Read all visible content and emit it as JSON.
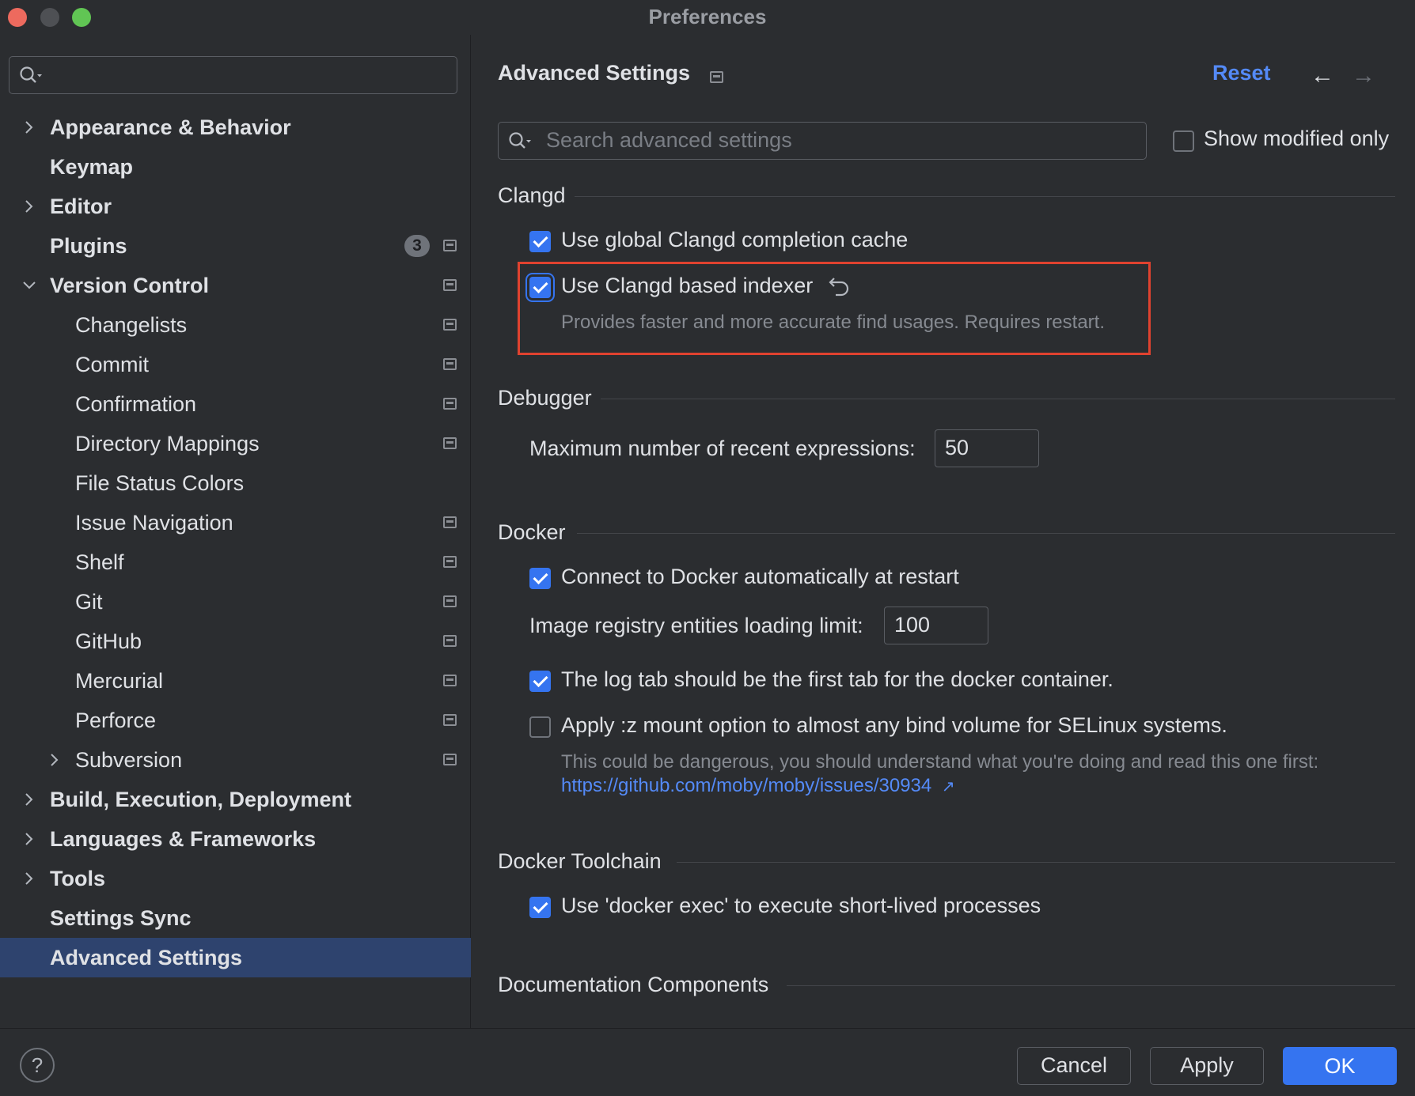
{
  "window": {
    "title": "Preferences"
  },
  "sidebar": {
    "search_placeholder": "",
    "items": [
      {
        "label": "Appearance & Behavior",
        "level": 0,
        "expander": "collapsed",
        "icon": false
      },
      {
        "label": "Keymap",
        "level": 0,
        "expander": "none",
        "icon": false
      },
      {
        "label": "Editor",
        "level": 0,
        "expander": "collapsed",
        "icon": false
      },
      {
        "label": "Plugins",
        "level": 0,
        "expander": "none",
        "icon": true,
        "badge": "3"
      },
      {
        "label": "Version Control",
        "level": 0,
        "expander": "expanded",
        "icon": true
      },
      {
        "label": "Changelists",
        "level": 1,
        "expander": "none",
        "icon": true
      },
      {
        "label": "Commit",
        "level": 1,
        "expander": "none",
        "icon": true
      },
      {
        "label": "Confirmation",
        "level": 1,
        "expander": "none",
        "icon": true
      },
      {
        "label": "Directory Mappings",
        "level": 1,
        "expander": "none",
        "icon": true
      },
      {
        "label": "File Status Colors",
        "level": 1,
        "expander": "none",
        "icon": false
      },
      {
        "label": "Issue Navigation",
        "level": 1,
        "expander": "none",
        "icon": true
      },
      {
        "label": "Shelf",
        "level": 1,
        "expander": "none",
        "icon": true
      },
      {
        "label": "Git",
        "level": 1,
        "expander": "none",
        "icon": true
      },
      {
        "label": "GitHub",
        "level": 1,
        "expander": "none",
        "icon": true
      },
      {
        "label": "Mercurial",
        "level": 1,
        "expander": "none",
        "icon": true
      },
      {
        "label": "Perforce",
        "level": 1,
        "expander": "none",
        "icon": true
      },
      {
        "label": "Subversion",
        "level": 1,
        "expander": "collapsed",
        "icon": true
      },
      {
        "label": "Build, Execution, Deployment",
        "level": 0,
        "expander": "collapsed",
        "icon": false
      },
      {
        "label": "Languages & Frameworks",
        "level": 0,
        "expander": "collapsed",
        "icon": false
      },
      {
        "label": "Tools",
        "level": 0,
        "expander": "collapsed",
        "icon": false
      },
      {
        "label": "Settings Sync",
        "level": 0,
        "expander": "none",
        "icon": false
      },
      {
        "label": "Advanced Settings",
        "level": 0,
        "expander": "none",
        "icon": false,
        "selected": true
      }
    ]
  },
  "main": {
    "title": "Advanced Settings",
    "reset_label": "Reset",
    "back_arrow": "←",
    "forward_arrow": "→",
    "search_placeholder": "Search advanced settings",
    "show_modified_label": "Show modified only",
    "sections": {
      "clangd": {
        "title": "Clangd",
        "completion_cache_label": "Use global Clangd completion cache",
        "indexer_label": "Use Clangd based indexer",
        "indexer_hint": "Provides faster and more accurate find usages. Requires restart."
      },
      "debugger": {
        "title": "Debugger",
        "max_expressions_label": "Maximum number of recent expressions:",
        "max_expressions_value": "50"
      },
      "docker": {
        "title": "Docker",
        "connect_label": "Connect to Docker automatically at restart",
        "registry_limit_label": "Image registry entities loading limit:",
        "registry_limit_value": "100",
        "log_tab_label": "The log tab should be the first tab for the docker container.",
        "selinux_label": "Apply :z mount option to almost any bind volume for SELinux systems.",
        "selinux_hint": "This could be dangerous, you should understand what you're doing and read this one first:",
        "selinux_link": "https://github.com/moby/moby/issues/30934",
        "link_arrow": "↗"
      },
      "docker_toolchain": {
        "title": "Docker Toolchain",
        "docker_exec_label": "Use 'docker exec' to execute short-lived processes"
      },
      "documentation": {
        "title": "Documentation Components"
      }
    }
  },
  "checkbox_states": {
    "show_modified": false,
    "completion_cache": true,
    "indexer": true,
    "docker_connect": true,
    "log_tab": true,
    "selinux": false,
    "docker_exec": true
  },
  "footer": {
    "help_label": "?",
    "cancel_label": "Cancel",
    "apply_label": "Apply",
    "ok_label": "OK"
  },
  "colors": {
    "accent": "#3574f0",
    "link": "#548af7",
    "highlight_box": "#e0422f",
    "selection": "#2e436e",
    "background": "#2b2d30"
  }
}
